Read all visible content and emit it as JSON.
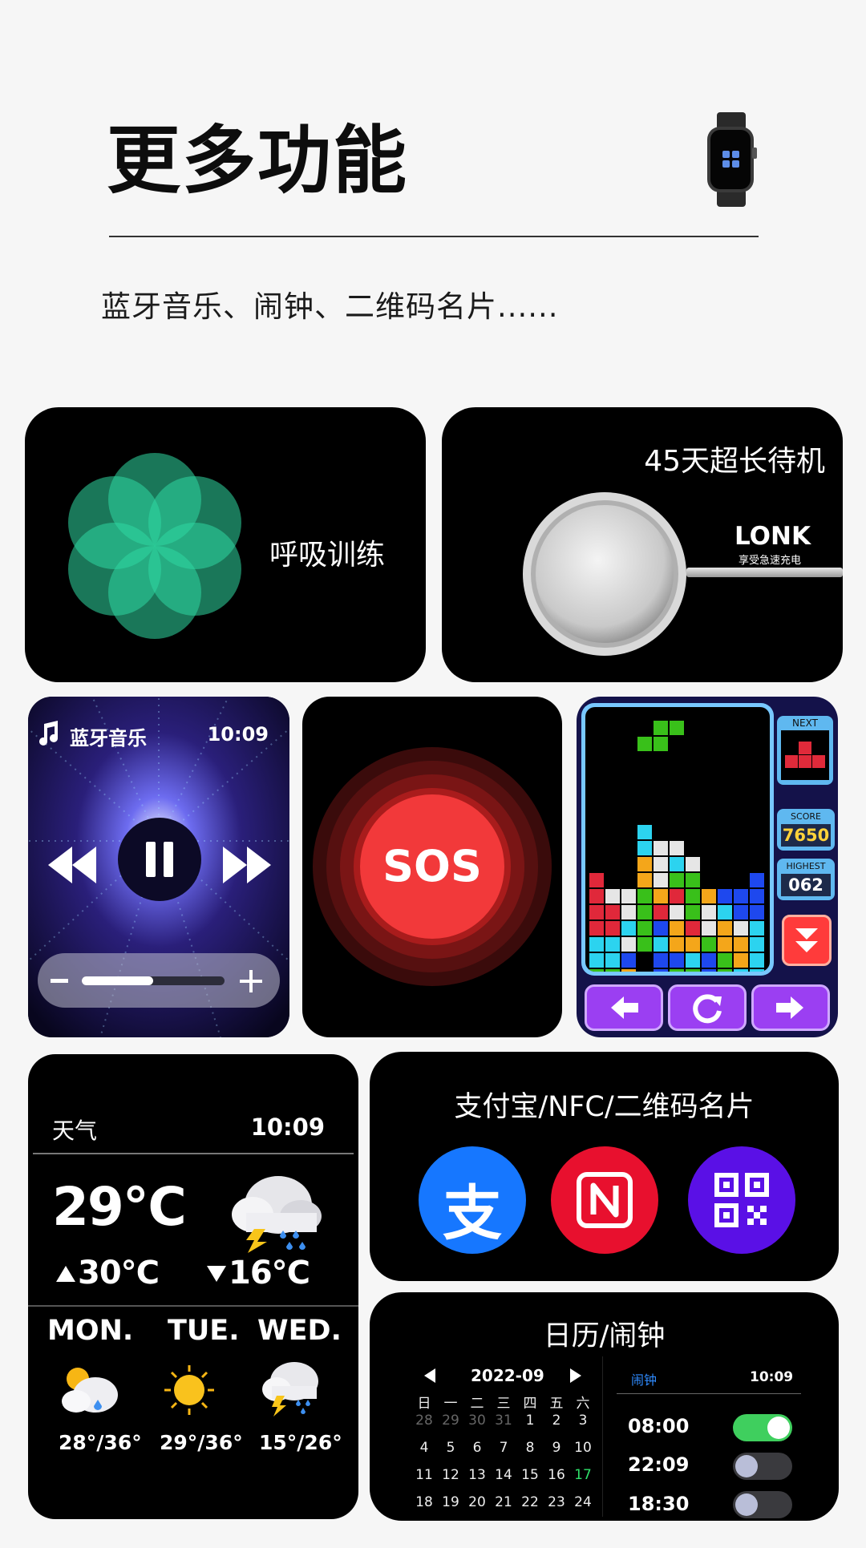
{
  "header": {
    "title": "更多功能",
    "subtitle": "蓝牙音乐、闹钟、二维码名片......"
  },
  "breathe": {
    "label": "呼吸训练"
  },
  "standby": {
    "title": "45天超长待机",
    "brand": "LONK",
    "tagline": "享受急速充电"
  },
  "music": {
    "title": "蓝牙音乐",
    "time": "10:09",
    "volume_level": 0.5
  },
  "sos": {
    "label": "SOS"
  },
  "tetris": {
    "next_label": "NEXT",
    "score_label": "SCORE",
    "score_value": "7650",
    "highest_label": "HIGHEST",
    "highest_value": "062"
  },
  "weather": {
    "title": "天气",
    "time": "10:09",
    "current_temp": "29℃",
    "high": "30℃",
    "low": "16℃",
    "forecast": [
      {
        "day": "MON.",
        "range": "28°/36°",
        "icon": "cloudy-rain-sun-icon"
      },
      {
        "day": "TUE.",
        "range": "29°/36°",
        "icon": "sun-icon"
      },
      {
        "day": "WED.",
        "range": "15°/26°",
        "icon": "thunderstorm-icon"
      }
    ]
  },
  "pay": {
    "title": "支付宝/NFC/二维码名片",
    "alipay_glyph": "支",
    "colors": {
      "alipay": "#1677ff",
      "nfc": "#e8102e",
      "qr": "#5a10e6"
    }
  },
  "calendar": {
    "title": "日历/闹钟",
    "month": "2022-09",
    "weekdays": [
      "日",
      "一",
      "二",
      "三",
      "四",
      "五",
      "六"
    ],
    "rows": [
      [
        "28",
        "29",
        "30",
        "31",
        "1",
        "2",
        "3"
      ],
      [
        "4",
        "5",
        "6",
        "7",
        "8",
        "9",
        "10"
      ],
      [
        "11",
        "12",
        "13",
        "14",
        "15",
        "16",
        "17"
      ],
      [
        "18",
        "19",
        "20",
        "21",
        "22",
        "23",
        "24"
      ]
    ],
    "today": "17",
    "alarm_title": "闹钟",
    "alarm_time": "10:09",
    "alarms": [
      {
        "time": "08:00",
        "on": true
      },
      {
        "time": "22:09",
        "on": false
      },
      {
        "time": "18:30",
        "on": false
      }
    ]
  }
}
